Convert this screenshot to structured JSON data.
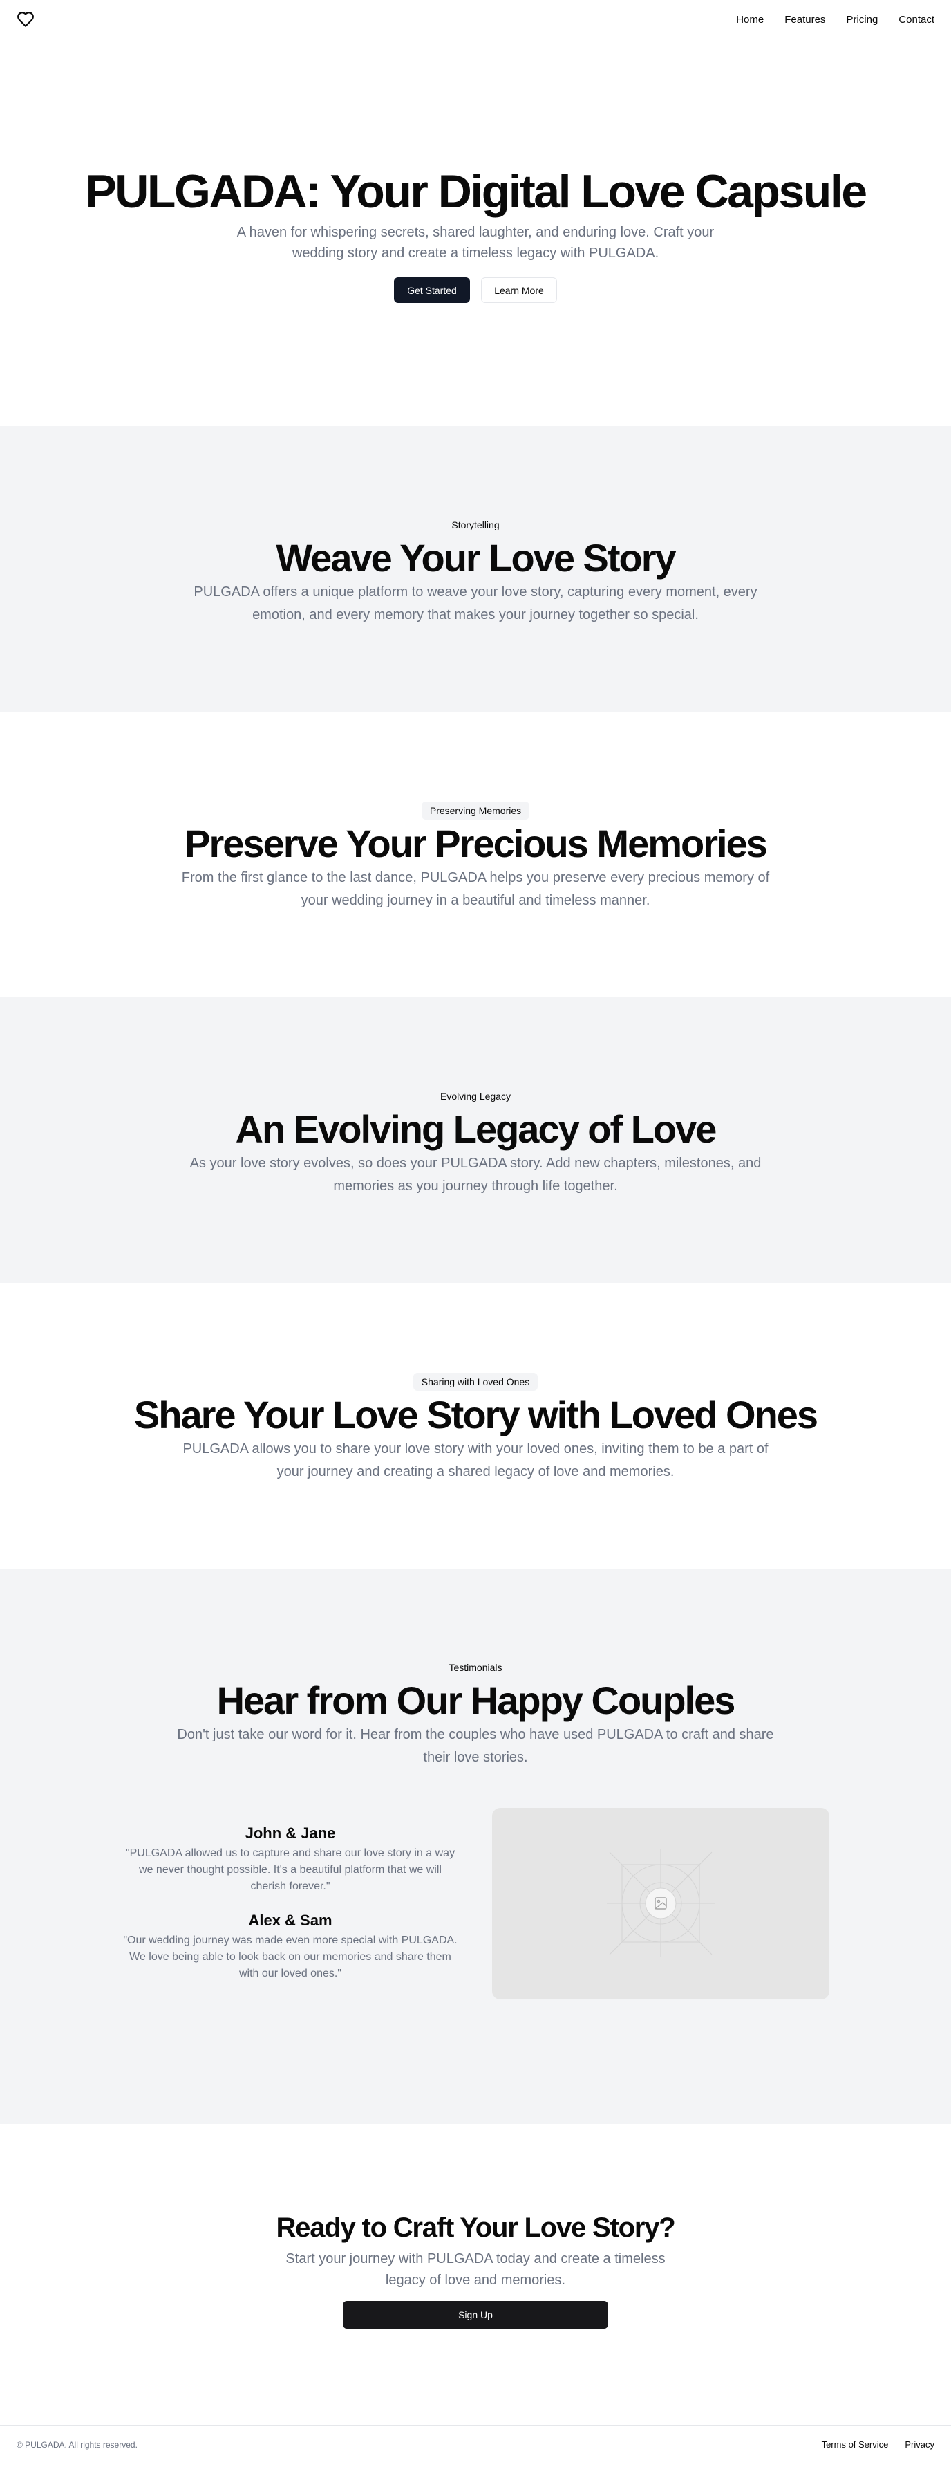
{
  "header": {
    "logo_icon": "heart-icon",
    "nav": [
      "Home",
      "Features",
      "Pricing",
      "Contact"
    ]
  },
  "hero": {
    "title": "PULGADA: Your Digital Love Capsule",
    "subtitle": "A haven for whispering secrets, shared laughter, and enduring love. Craft your wedding story and create a timeless legacy with PULGADA.",
    "primary_button": "Get Started",
    "secondary_button": "Learn More"
  },
  "sections": [
    {
      "tag": "Storytelling",
      "title": "Weave Your Love Story",
      "text": "PULGADA offers a unique platform to weave your love story, capturing every moment, every emotion, and every memory that makes your journey together so special."
    },
    {
      "tag": "Preserving Memories",
      "title": "Preserve Your Precious Memories",
      "text": "From the first glance to the last dance, PULGADA helps you preserve every precious memory of your wedding journey in a beautiful and timeless manner."
    },
    {
      "tag": "Evolving Legacy",
      "title": "An Evolving Legacy of Love",
      "text": "As your love story evolves, so does your PULGADA story. Add new chapters, milestones, and memories as you journey through life together."
    },
    {
      "tag": "Sharing with Loved Ones",
      "title": "Share Your Love Story with Loved Ones",
      "text": "PULGADA allows you to share your love story with your loved ones, inviting them to be a part of your journey and creating a shared legacy of love and memories."
    }
  ],
  "testimonials": {
    "tag": "Testimonials",
    "title": "Hear from Our Happy Couples",
    "text": "Don't just take our word for it. Hear from the couples who have used PULGADA to craft and share their love stories.",
    "items": [
      {
        "name": "John & Jane",
        "quote": "\"PULGADA allowed us to capture and share our love story in a way we never thought possible. It's a beautiful platform that we will cherish forever.\""
      },
      {
        "name": "Alex & Sam",
        "quote": "\"Our wedding journey was made even more special with PULGADA. We love being able to look back on our memories and share them with our loved ones.\""
      }
    ],
    "media_icon": "image-placeholder-icon"
  },
  "cta": {
    "title": "Ready to Craft Your Love Story?",
    "text": "Start your journey with PULGADA today and create a timeless legacy of love and memories.",
    "button": "Sign Up"
  },
  "footer": {
    "copyright": "© PULGADA. All rights reserved.",
    "links": [
      "Terms of Service",
      "Privacy"
    ]
  }
}
